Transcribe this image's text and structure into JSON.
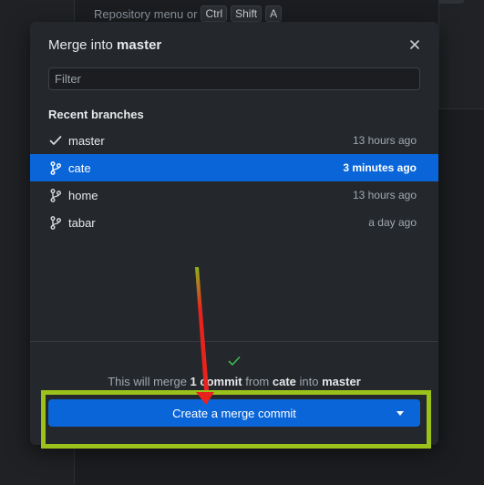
{
  "background": {
    "hint_text": "Repository menu or",
    "keys": [
      "Ctrl",
      "Shift",
      "A"
    ]
  },
  "dialog": {
    "title_prefix": "Merge into",
    "title_branch": "master",
    "close_icon": "close-icon",
    "filter": {
      "placeholder": "Filter",
      "value": ""
    },
    "section_title": "Recent branches",
    "branches": [
      {
        "name": "master",
        "time": "13 hours ago",
        "icon": "check-icon",
        "selected": false
      },
      {
        "name": "cate",
        "time": "3 minutes ago",
        "icon": "branch-icon",
        "selected": true
      },
      {
        "name": "home",
        "time": "13 hours ago",
        "icon": "branch-icon",
        "selected": false
      },
      {
        "name": "tabar",
        "time": "a day ago",
        "icon": "branch-icon",
        "selected": false
      }
    ],
    "footer": {
      "status_icon": "check-icon",
      "status_color": "#3fb950",
      "msg_prefix": "This will merge",
      "msg_count": "1 commit",
      "msg_from": "from",
      "msg_source": "cate",
      "msg_into": "into",
      "msg_target": "master",
      "button_label": "Create a merge commit",
      "button_dropdown_icon": "caret-down-icon"
    }
  },
  "colors": {
    "accent": "#0a65d8",
    "highlight_box": "#9bc21b",
    "arrow": "#e8231d"
  }
}
